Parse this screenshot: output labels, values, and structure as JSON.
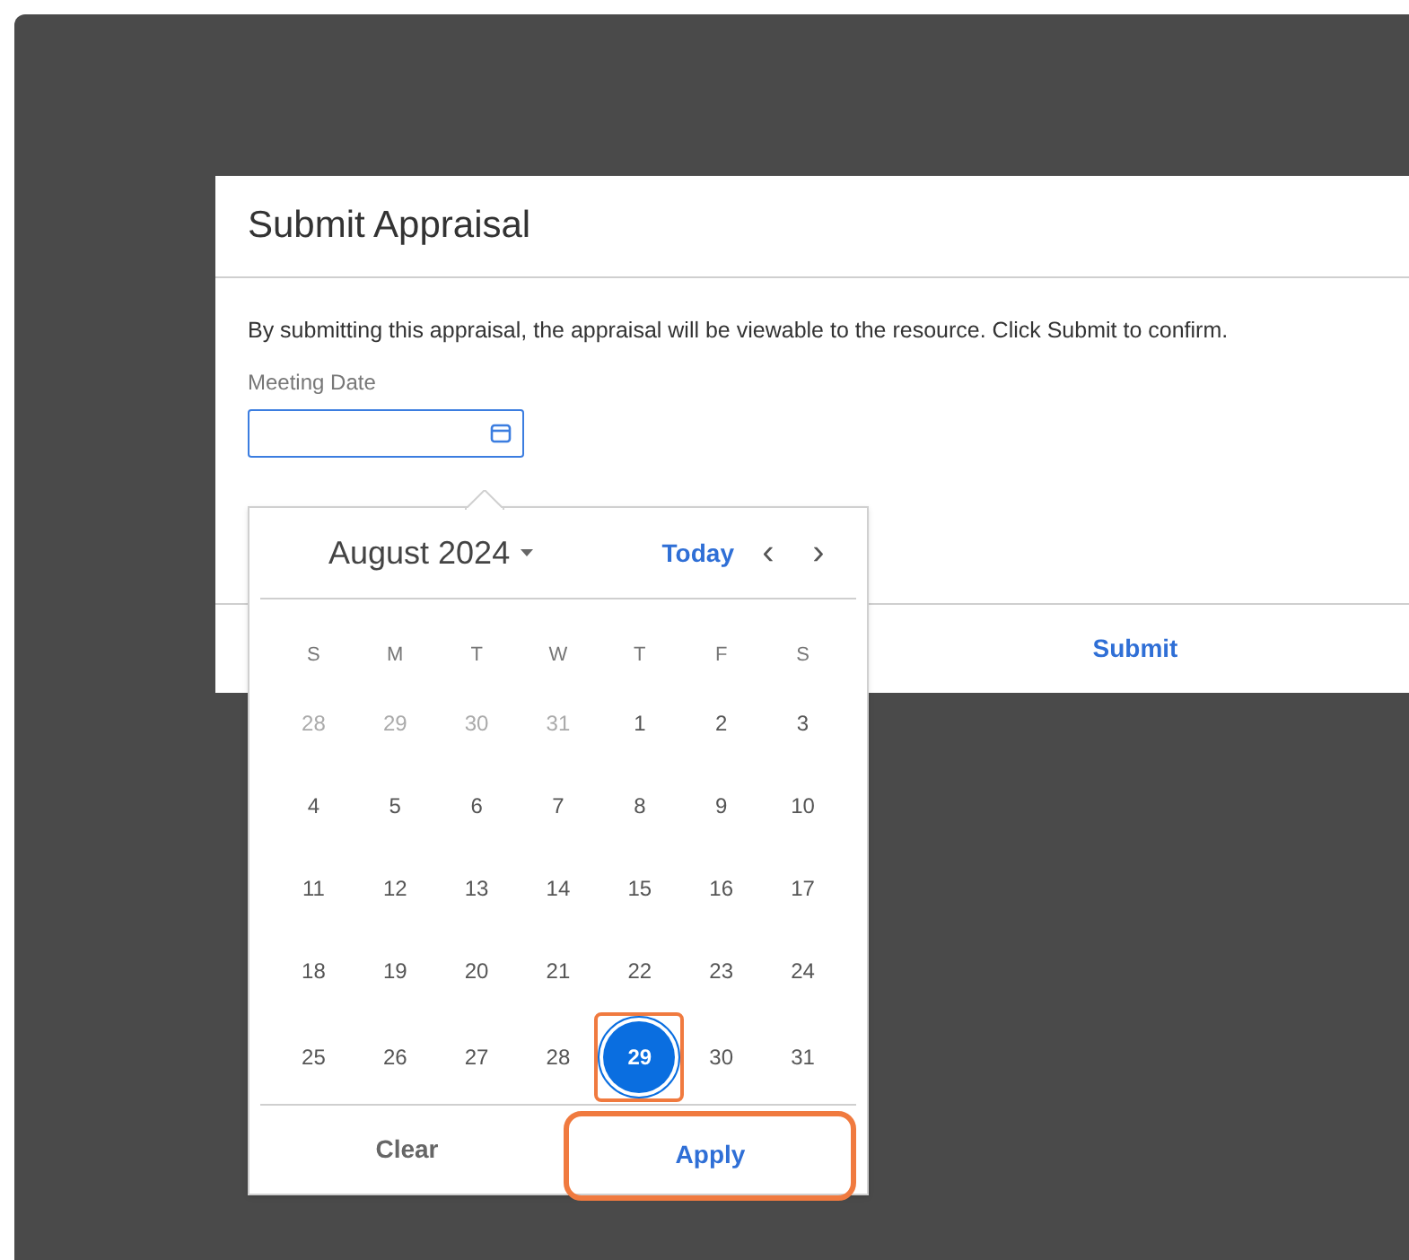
{
  "dialog": {
    "title": "Submit Appraisal",
    "message": "By submitting this appraisal, the appraisal will be viewable to the resource. Click Submit to confirm.",
    "field_label": "Meeting Date",
    "submit": "Submit"
  },
  "calendar": {
    "month": "August 2024",
    "today": "Today",
    "prev": "‹",
    "next": "›",
    "weekdays": [
      "S",
      "M",
      "T",
      "W",
      "T",
      "F",
      "S"
    ],
    "weeks": [
      [
        {
          "day": "28",
          "kind": "other",
          "selected": false
        },
        {
          "day": "29",
          "kind": "other",
          "selected": false
        },
        {
          "day": "30",
          "kind": "other",
          "selected": false
        },
        {
          "day": "31",
          "kind": "other",
          "selected": false
        },
        {
          "day": "1",
          "kind": "current",
          "selected": false
        },
        {
          "day": "2",
          "kind": "current",
          "selected": false
        },
        {
          "day": "3",
          "kind": "current",
          "selected": false
        }
      ],
      [
        {
          "day": "4",
          "kind": "current",
          "selected": false
        },
        {
          "day": "5",
          "kind": "current",
          "selected": false
        },
        {
          "day": "6",
          "kind": "current",
          "selected": false
        },
        {
          "day": "7",
          "kind": "current",
          "selected": false
        },
        {
          "day": "8",
          "kind": "current",
          "selected": false
        },
        {
          "day": "9",
          "kind": "current",
          "selected": false
        },
        {
          "day": "10",
          "kind": "current",
          "selected": false
        }
      ],
      [
        {
          "day": "11",
          "kind": "current",
          "selected": false
        },
        {
          "day": "12",
          "kind": "current",
          "selected": false
        },
        {
          "day": "13",
          "kind": "current",
          "selected": false
        },
        {
          "day": "14",
          "kind": "current",
          "selected": false
        },
        {
          "day": "15",
          "kind": "current",
          "selected": false
        },
        {
          "day": "16",
          "kind": "current",
          "selected": false
        },
        {
          "day": "17",
          "kind": "current",
          "selected": false
        }
      ],
      [
        {
          "day": "18",
          "kind": "current",
          "selected": false
        },
        {
          "day": "19",
          "kind": "current",
          "selected": false
        },
        {
          "day": "20",
          "kind": "current",
          "selected": false
        },
        {
          "day": "21",
          "kind": "current",
          "selected": false
        },
        {
          "day": "22",
          "kind": "current",
          "selected": false
        },
        {
          "day": "23",
          "kind": "current",
          "selected": false
        },
        {
          "day": "24",
          "kind": "current",
          "selected": false
        }
      ],
      [
        {
          "day": "25",
          "kind": "current",
          "selected": false
        },
        {
          "day": "26",
          "kind": "current",
          "selected": false
        },
        {
          "day": "27",
          "kind": "current",
          "selected": false
        },
        {
          "day": "28",
          "kind": "current",
          "selected": false
        },
        {
          "day": "29",
          "kind": "current",
          "selected": true
        },
        {
          "day": "30",
          "kind": "current",
          "selected": false
        },
        {
          "day": "31",
          "kind": "current",
          "selected": false
        }
      ]
    ],
    "clear": "Clear",
    "apply": "Apply"
  }
}
